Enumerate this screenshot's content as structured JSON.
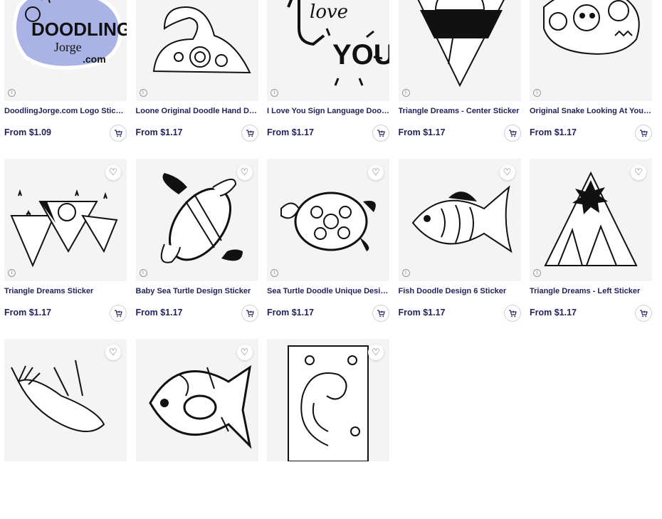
{
  "products": [
    {
      "title": "DoodlingJorge.com Logo Sticker",
      "price": "From $1.09",
      "art": "logo"
    },
    {
      "title": "Loone Original Doodle Hand Dra...",
      "price": "From $1.17",
      "art": "duck"
    },
    {
      "title": "I Love You Sign Language Doodl...",
      "price": "From $1.17",
      "art": "loveyou"
    },
    {
      "title": "Triangle Dreams - Center Sticker",
      "price": "From $1.17",
      "art": "triangle-center"
    },
    {
      "title": "Original Snake Looking At You S...",
      "price": "From $1.17",
      "art": "snake"
    },
    {
      "title": "Triangle Dreams Sticker",
      "price": "From $1.17",
      "art": "triangles"
    },
    {
      "title": "Baby Sea Turtle Design Sticker",
      "price": "From $1.17",
      "art": "turtle"
    },
    {
      "title": "Sea Turtle Doodle Unique Desig...",
      "price": "From $1.17",
      "art": "seaturtle"
    },
    {
      "title": "Fish Doodle Design 6 Sticker",
      "price": "From $1.17",
      "art": "fish"
    },
    {
      "title": "Triangle Dreams - Left Sticker",
      "price": "From $1.17",
      "art": "triangle-left"
    },
    {
      "title": "",
      "price": "",
      "art": "whale"
    },
    {
      "title": "",
      "price": "",
      "art": "fish2"
    },
    {
      "title": "",
      "price": "",
      "art": "paisley"
    }
  ],
  "logo_text": {
    "line1": "DOODLING",
    "line2": "Jorge",
    "line3": ".com"
  },
  "loveyou_text": {
    "love": "love",
    "you": "YOU"
  },
  "icons": {
    "favorite": "heart-icon",
    "cart": "add-to-cart-icon",
    "info": "info-icon"
  },
  "colors": {
    "logo_blob": "#aab3e6",
    "text": "#23235c",
    "thumb_bg": "#f4f4f4"
  }
}
